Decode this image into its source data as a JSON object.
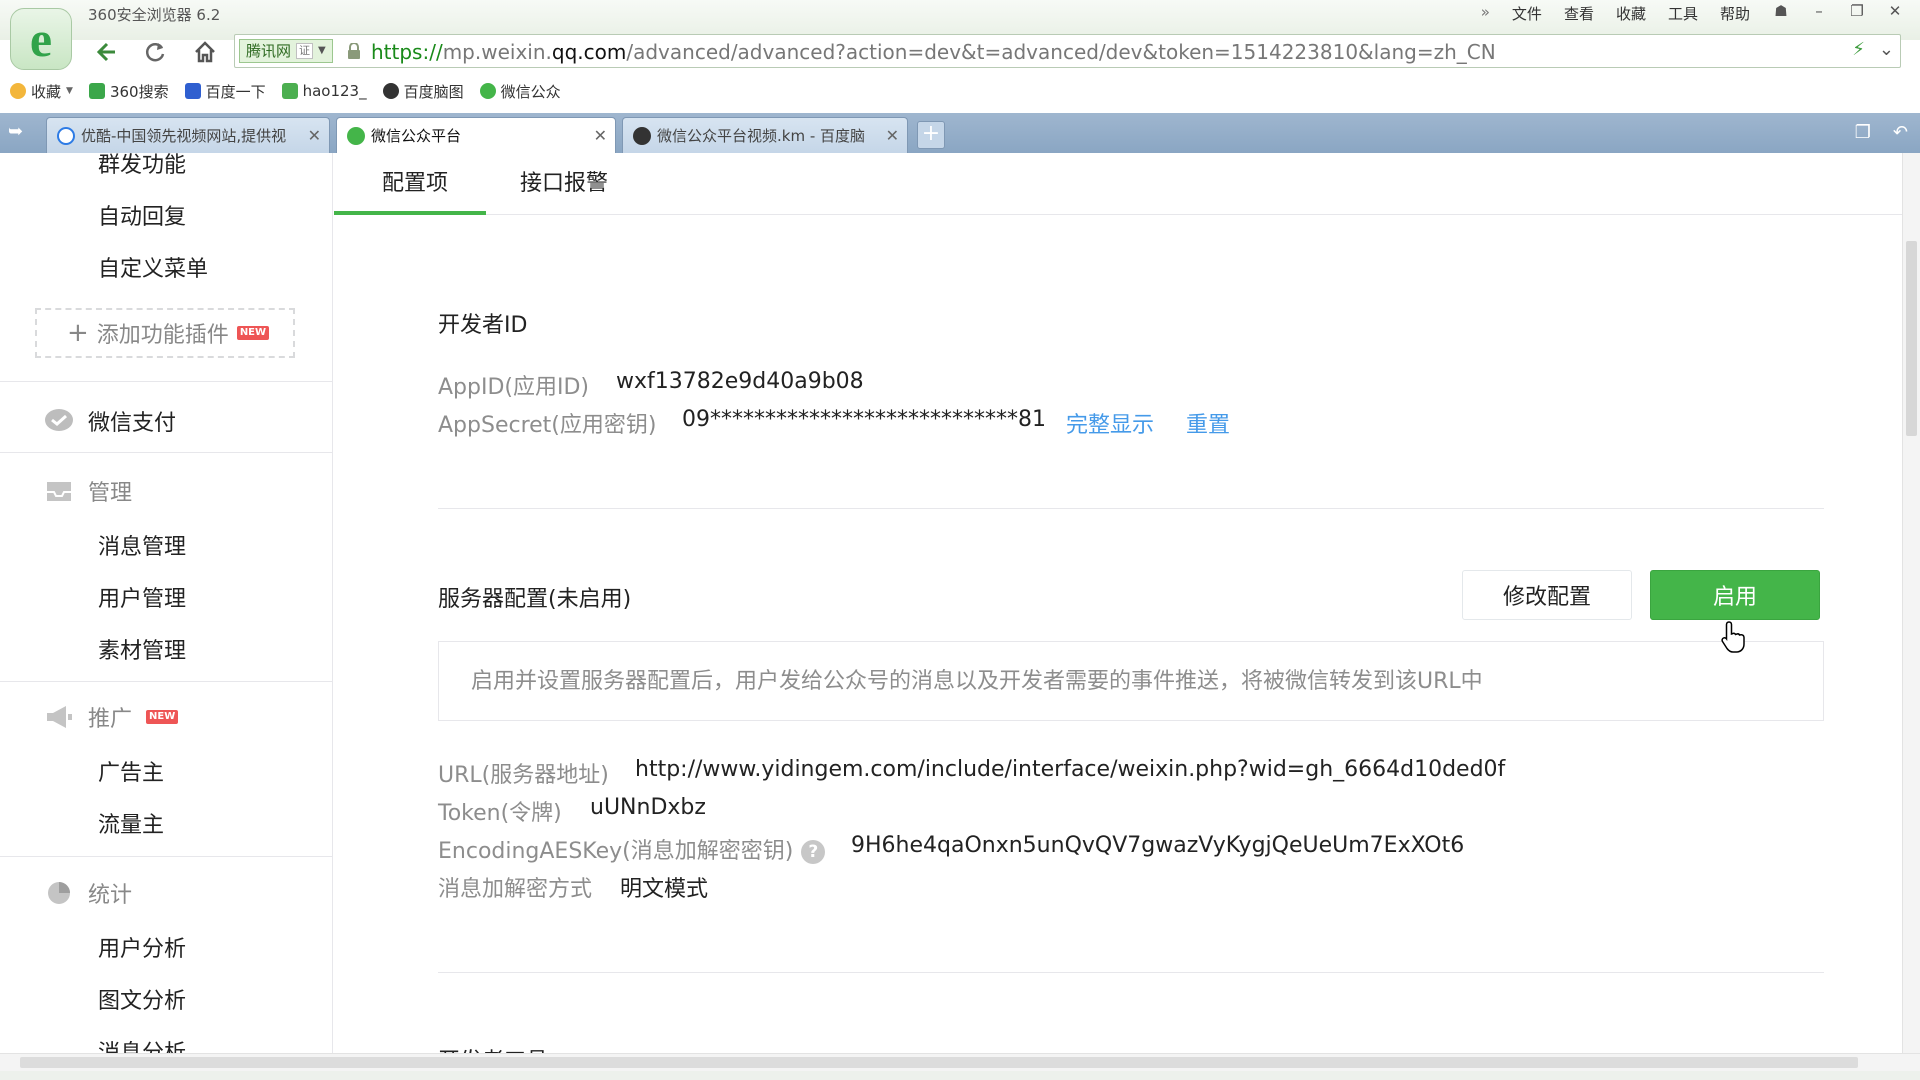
{
  "browser": {
    "app_title": "360安全浏览器 6.2",
    "menu": [
      "文件",
      "查看",
      "收藏",
      "工具",
      "帮助"
    ],
    "site_tag": "腾讯网",
    "cert_label": "证",
    "url_proto": "https://",
    "url_host_pre": "mp.weixin.",
    "url_host": "qq.com",
    "url_path": "/advanced/advanced?action=dev&t=advanced/dev&token=1514223810&lang=zh_CN",
    "bookmarks": [
      "收藏",
      "360搜索",
      "百度一下",
      "hao123_",
      "百度脑图",
      "微信公众"
    ],
    "tabs": [
      {
        "title": "优酷-中国领先视频网站,提供视"
      },
      {
        "title": "微信公众平台"
      },
      {
        "title": "微信公众平台视频.km - 百度脑"
      }
    ]
  },
  "sidebar": {
    "items_top": [
      "群发功能",
      "自动回复",
      "自定义菜单"
    ],
    "add_plugin": "添加功能插件",
    "new_badge": "NEW",
    "pay": "微信支付",
    "manage_group": "管理",
    "manage_items": [
      "消息管理",
      "用户管理",
      "素材管理"
    ],
    "promo_group": "推广",
    "promo_items": [
      "广告主",
      "流量主"
    ],
    "stats_group": "统计",
    "stats_items": [
      "用户分析",
      "图文分析",
      "消息分析"
    ]
  },
  "main": {
    "tabs": [
      "配置项",
      "接口报警"
    ],
    "dev_id_title": "开发者ID",
    "appid_label": "AppID(应用ID)",
    "appid_value": "wxf13782e9d40a9b08",
    "secret_label": "AppSecret(应用密钥)",
    "secret_value": "09****************************81",
    "show_full": "完整显示",
    "reset": "重置",
    "server_title": "服务器配置(未启用)",
    "modify_btn": "修改配置",
    "enable_btn": "启用",
    "notice": "启用并设置服务器配置后，用户发给公众号的消息以及开发者需要的事件推送，将被微信转发到该URL中",
    "url_label": "URL(服务器地址)",
    "url_value": "http://www.yidingem.com/include/interface/weixin.php?wid=gh_6664d10ded0f",
    "token_label": "Token(令牌)",
    "token_value": "uUNnDxbz",
    "aes_label": "EncodingAESKey(消息加解密密钥)",
    "aes_value": "9H6he4qaOnxn5unQvQV7gwazVyKygjQeUeUm7ExXOt6",
    "mode_label": "消息加解密方式",
    "mode_value": "明文模式",
    "dev_tools_title": "开发者工具"
  },
  "colors": {
    "accent_green": "#44b549",
    "link_blue": "#459ae9",
    "tabbar_blue": "#8aa6c3"
  }
}
